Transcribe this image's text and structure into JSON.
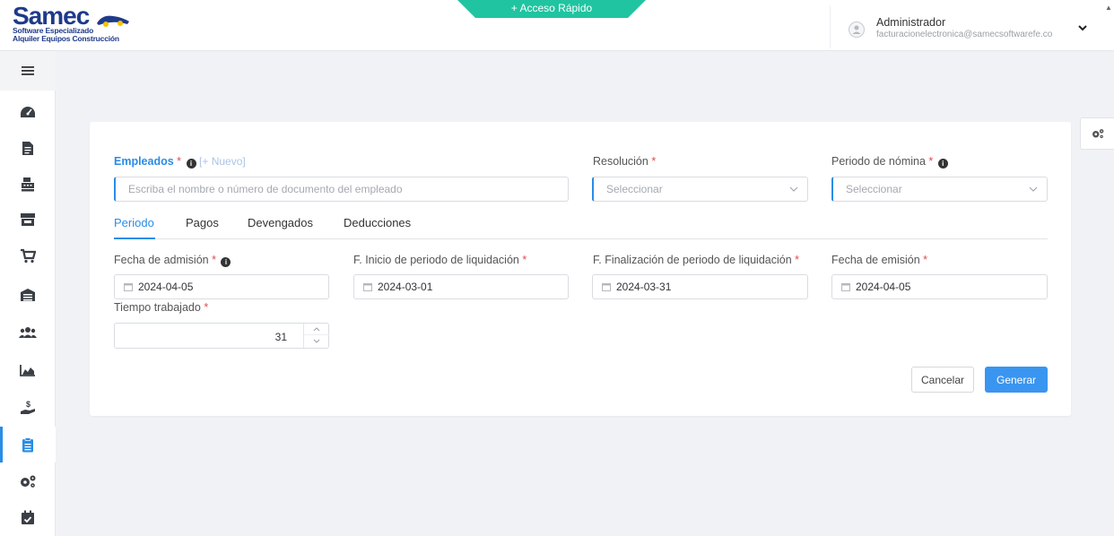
{
  "header": {
    "logo_text": "Samec",
    "logo_subtitle_1": "Software Especializado",
    "logo_subtitle_2": "Alquiler Equipos Construcción",
    "quick_access": "+ Acceso Rápido",
    "user_name": "Administrador",
    "user_email": "facturacionelectronica@samecsoftwarefe.co"
  },
  "sidebar": {
    "items": [
      {
        "icon": "dashboard-icon"
      },
      {
        "icon": "document-icon"
      },
      {
        "icon": "cash-register-icon"
      },
      {
        "icon": "store-icon"
      },
      {
        "icon": "cart-icon"
      },
      {
        "icon": "warehouse-icon"
      },
      {
        "icon": "users-icon"
      },
      {
        "icon": "chart-icon"
      },
      {
        "icon": "hand-money-icon"
      },
      {
        "icon": "clipboard-icon",
        "active": true
      },
      {
        "icon": "gears-icon"
      },
      {
        "icon": "calendar-check-icon"
      }
    ]
  },
  "form": {
    "empleados_label": "Empleados",
    "nuevo_link": "[+ Nuevo]",
    "empleados_placeholder": "Escriba el nombre o número de documento del empleado",
    "resolucion_label": "Resolución",
    "resolucion_placeholder": "Seleccionar",
    "periodo_nomina_label": "Periodo de nómina",
    "periodo_nomina_placeholder": "Seleccionar",
    "required_mark": "*",
    "tabs": [
      {
        "label": "Periodo",
        "active": true
      },
      {
        "label": "Pagos"
      },
      {
        "label": "Devengados"
      },
      {
        "label": "Deducciones"
      }
    ],
    "fecha_admision_label": "Fecha de admisión",
    "fecha_admision_value": "2024-04-05",
    "inicio_periodo_label": "F. Inicio de periodo de liquidación",
    "inicio_periodo_value": "2024-03-01",
    "fin_periodo_label": "F. Finalización de periodo de liquidación",
    "fin_periodo_value": "2024-03-31",
    "fecha_emision_label": "Fecha de emisión",
    "fecha_emision_value": "2024-04-05",
    "tiempo_trabajado_label": "Tiempo trabajado",
    "tiempo_trabajado_value": "31",
    "cancel_label": "Cancelar",
    "generate_label": "Generar"
  },
  "colors": {
    "accent": "#2a8ce6",
    "quick_access": "#20c4a0",
    "required": "#e24b4b"
  }
}
